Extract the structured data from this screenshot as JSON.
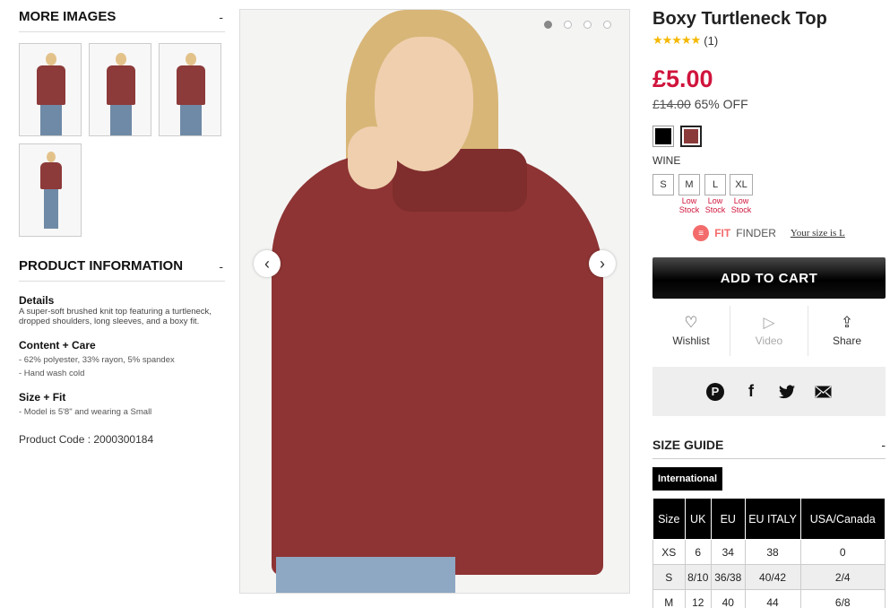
{
  "left": {
    "more_images": {
      "title": "MORE IMAGES",
      "toggle": "-"
    },
    "product_info": {
      "title": "PRODUCT INFORMATION",
      "toggle": "-"
    },
    "details_title": "Details",
    "details_text": "A super-soft brushed knit top featuring a turtleneck, dropped shoulders, long sleeves, and a boxy fit.",
    "content_title": "Content + Care",
    "content_lines": [
      "- 62% polyester, 33% rayon, 5% spandex",
      "- Hand wash cold"
    ],
    "size_fit_title": "Size + Fit",
    "size_fit_lines": [
      "- Model is 5'8\" and wearing a Small"
    ],
    "product_code": "Product Code : 2000300184"
  },
  "gallery": {
    "prev_icon": "chevron-left-icon",
    "next_icon": "chevron-right-icon",
    "prev_glyph": "‹",
    "next_glyph": "›",
    "active_dot": 0
  },
  "product": {
    "title": "Boxy Turtleneck Top",
    "stars": "★★★★★",
    "review_count": "(1)",
    "price": "£5.00",
    "was_price": "£14.00",
    "discount": "65% OFF",
    "swatch_colors": [
      "#000000",
      "#8b3a3a"
    ],
    "selected_color": "WINE",
    "sizes": [
      {
        "label": "S",
        "note": ""
      },
      {
        "label": "M",
        "note": "Low Stock"
      },
      {
        "label": "L",
        "note": "Low Stock"
      },
      {
        "label": "XL",
        "note": "Low Stock"
      }
    ],
    "fit_finder": {
      "part1": "FIT",
      "part2": "FINDER",
      "your_size": "Your size is L"
    },
    "add_to_cart": "ADD TO CART",
    "actions": {
      "wishlist": "Wishlist",
      "video": "Video",
      "share": "Share"
    },
    "accent_color": "#d0143c"
  },
  "size_guide": {
    "title": "SIZE GUIDE",
    "toggle": "-",
    "tab": "International",
    "headers": [
      "Size",
      "UK",
      "EU",
      "EU ITALY",
      "USA/Canada"
    ],
    "rows": [
      [
        "XS",
        "6",
        "34",
        "38",
        "0"
      ],
      [
        "S",
        "8/10",
        "36/38",
        "40/42",
        "2/4"
      ],
      [
        "M",
        "12",
        "40",
        "44",
        "6/8"
      ]
    ]
  }
}
